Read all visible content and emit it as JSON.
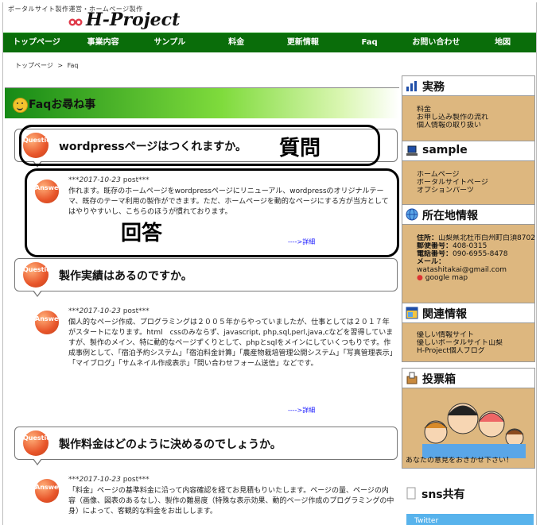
{
  "header": {
    "tagline": "ポータルサイト製作運営・ホームページ製作",
    "logo": "H-Project"
  },
  "nav": [
    "トップページ",
    "事業内容",
    "サンプル",
    "料金",
    "更新情報",
    "Faq",
    "お問い合わせ",
    "地図"
  ],
  "breadcrumb": {
    "home": "トップページ",
    "sep": ">",
    "current": "Faq"
  },
  "section_title": "Faqお尋ね事",
  "badges": {
    "question": "Question",
    "answer": "Answer"
  },
  "faq": [
    {
      "question": "wordpressページはつくれますか。",
      "date": "2017-10-23",
      "post": "post",
      "answer": "作れます。既存のホームページをwordpressページにリニューアル、wordpressのオリジナルテーマ、既存のテーマ利用の製作ができます。ただ、ホームページを動的なページにする方が当方としてはやりやすいし、こちらのほうが慣れております。",
      "more": "---->詳細"
    },
    {
      "question": "製作実績はあるのですか。",
      "date": "2017-10-23",
      "post": "post",
      "answer": "個人的なページ作成、プログラミングは２００５年からやっていましたが、仕事としては２０１７年がスタートになります。html　cssのみならず、javascript, php,sql,perl,java,cなどを習得していますが、製作のメイン、特に動的なページずくりとして、phpとsqlをメインにしていくつもりです。作成事例として、「宿泊予約システム」「宿泊料金計算」「農産物栽培管理公開システム」「写真管理表示」「マイブログ」「サムネイル作成表示」「問い合わせフォーム送信」などです。",
      "more": "---->詳細"
    },
    {
      "question": "製作料金はどのように決めるのでしょうか。",
      "date": "2017-10-23",
      "post": "post",
      "answer": "「料金」ページの基準料金に沿って内容確認を経てお見積もりいたします。ページの量、ページの内容（画像、図表のあるなし）、製作の難易度（特殊な表示効果、動的ページ作成のプログラミングの中身）によって、客観的な料金をお出しします。",
      "more": "---->詳細"
    }
  ],
  "annotations": {
    "q": "質問",
    "a": "回答"
  },
  "sidebar": {
    "jitsumu": {
      "title": "実務",
      "items": [
        "料金",
        "お申し込み製作の流れ",
        "個人情報の取り扱い"
      ]
    },
    "sample": {
      "title": "sample",
      "items": [
        "ホームページ",
        "ポータルサイトページ",
        "オプションパーツ"
      ]
    },
    "location": {
      "title": "所在地情報",
      "address_label": "住所：",
      "address": "山梨県北杜市白州町白須8702-1",
      "zip_label": "郵便番号：",
      "zip": "408-0315",
      "tel_label": "電話番号：",
      "tel": "090-6955-8478",
      "mail_label": "メール：",
      "mail": "watashitakai@gmail.com",
      "map": "google map"
    },
    "related": {
      "title": "関連情報",
      "items": [
        "優しい情報サイト",
        "優しいポータルサイト山梨",
        "H-Project個人ブログ"
      ]
    },
    "vote": {
      "title": "投票箱",
      "caption": "あなたの意見をおきかせ下さい！"
    },
    "sns": {
      "title": "sns共有",
      "twitter": "Twitter"
    }
  },
  "colors": {
    "nav": "#0a6d0a",
    "sidebar_bg": "#ddb77f",
    "badge": "#e8552a",
    "link": "#1a1aff"
  }
}
